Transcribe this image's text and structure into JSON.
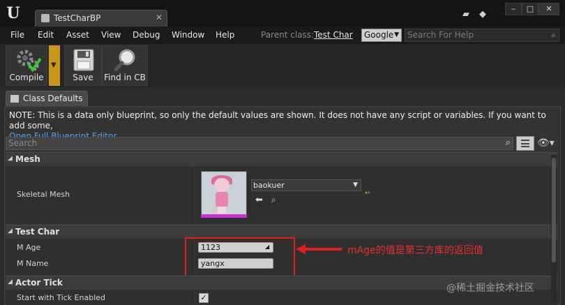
{
  "window": {
    "tab_title": "TestCharBP",
    "tab_close": "✕",
    "controls": {
      "minimize": "–",
      "maximize": "□",
      "close": "✕"
    }
  },
  "menu": {
    "items": [
      "File",
      "Edit",
      "Asset",
      "View",
      "Debug",
      "Window",
      "Help"
    ],
    "parent_class_label": "Parent class:",
    "parent_class_value": "Test Char",
    "search_provider": "Google",
    "help_search_placeholder": "Search For Help"
  },
  "toolbar": {
    "compile_label": "Compile",
    "save_label": "Save",
    "find_label": "Find in CB"
  },
  "details": {
    "tab_label": "Class Defaults",
    "note": "NOTE: This is a data only blueprint, so only the default values are shown.  It does not have any script or variables.  If you want to add some,",
    "note_link": "Open Full Blueprint Editor",
    "search_placeholder": "Search"
  },
  "categories": {
    "mesh": {
      "title": "Mesh",
      "skeletal_mesh_label": "Skeletal Mesh",
      "skeletal_mesh_value": "baokuer"
    },
    "test_char": {
      "title": "Test Char",
      "m_age_label": "M Age",
      "m_age_value": "1123",
      "m_name_label": "M Name",
      "m_name_value": "yangx"
    },
    "actor_tick": {
      "title": "Actor Tick",
      "start_tick_label": "Start with Tick Enabled",
      "start_tick_checked": true
    }
  },
  "annotation": "mAge的值是第三方库的返回值",
  "watermark": "@稀土掘金技术社区",
  "colors": {
    "accent_yellow": "#c7981b",
    "link": "#4ea6f0",
    "annotation_red": "#e53030",
    "thumbnail_bar": "#cc2fd0"
  }
}
